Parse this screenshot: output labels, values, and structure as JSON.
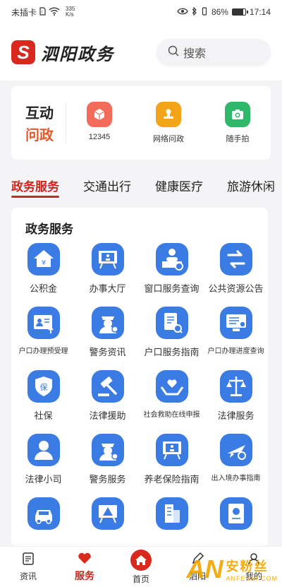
{
  "statusbar": {
    "carrier": "未插卡",
    "speed_num": "335",
    "speed_unit": "K/s",
    "battery": "86%",
    "time": "17:14",
    "battery_level": 0.86
  },
  "header": {
    "logo_char": "S",
    "app_name": "泗阳政务",
    "search_placeholder": "搜索"
  },
  "hudong": {
    "title_line1": "互动",
    "title_line2": "问政",
    "items": [
      {
        "label": "12345",
        "icon": "box-icon",
        "color": "#f26b5b"
      },
      {
        "label": "网络问政",
        "icon": "stamp-icon",
        "color": "#f3a51a"
      },
      {
        "label": "随手拍",
        "icon": "camera-icon",
        "color": "#2fb86a"
      }
    ]
  },
  "tabs": [
    {
      "label": "政务服务",
      "active": true
    },
    {
      "label": "交通出行",
      "active": false
    },
    {
      "label": "健康医疗",
      "active": false
    },
    {
      "label": "旅游休闲",
      "active": false
    }
  ],
  "panel": {
    "title": "政务服务",
    "items": [
      {
        "label": "公积金",
        "icon": "house-yuan-icon"
      },
      {
        "label": "办事大厅",
        "icon": "hall-board-icon"
      },
      {
        "label": "窗口服务查询",
        "icon": "service-desk-icon"
      },
      {
        "label": "公共资源公告",
        "icon": "exchange-arrows-icon"
      },
      {
        "label": "户口办理预受理",
        "icon": "id-card-upload-icon",
        "small": true
      },
      {
        "label": "警务资讯",
        "icon": "police-officer-icon"
      },
      {
        "label": "户口服务指南",
        "icon": "document-search-icon"
      },
      {
        "label": "户口办理进度查询",
        "icon": "monitor-search-icon",
        "small": true
      },
      {
        "label": "社保",
        "icon": "shield-bao-icon"
      },
      {
        "label": "法律援助",
        "icon": "gavel-icon"
      },
      {
        "label": "社会救助在线申报",
        "icon": "hands-heart-icon",
        "small": true
      },
      {
        "label": "法律服务",
        "icon": "scales-icon"
      },
      {
        "label": "法律小司",
        "icon": "person-icon"
      },
      {
        "label": "警务服务",
        "icon": "police-officer-icon"
      },
      {
        "label": "养老保险指南",
        "icon": "elder-board-icon"
      },
      {
        "label": "出入境办事指南",
        "icon": "airplane-icon",
        "small": true
      },
      {
        "label": "",
        "icon": "car-icon"
      },
      {
        "label": "",
        "icon": "warning-board-icon"
      },
      {
        "label": "",
        "icon": "building-icon"
      },
      {
        "label": "",
        "icon": "certificate-icon"
      }
    ]
  },
  "bottomnav": [
    {
      "label": "资讯",
      "icon": "news-icon",
      "active": false
    },
    {
      "label": "服务",
      "icon": "heart-icon",
      "active": true
    },
    {
      "label": "首页",
      "icon": "home-icon",
      "active": false
    },
    {
      "label": "泗阳",
      "icon": "pen-icon",
      "active": false
    },
    {
      "label": "我的",
      "icon": "user-icon",
      "active": false
    }
  ],
  "watermark": {
    "logo": "AN",
    "cn": "安粉丝",
    "en": "ANFENSI.COM"
  },
  "colors": {
    "brand_red": "#d9281e",
    "icon_blue": "#3b7ce4",
    "accent_orange": "#e8582a"
  }
}
